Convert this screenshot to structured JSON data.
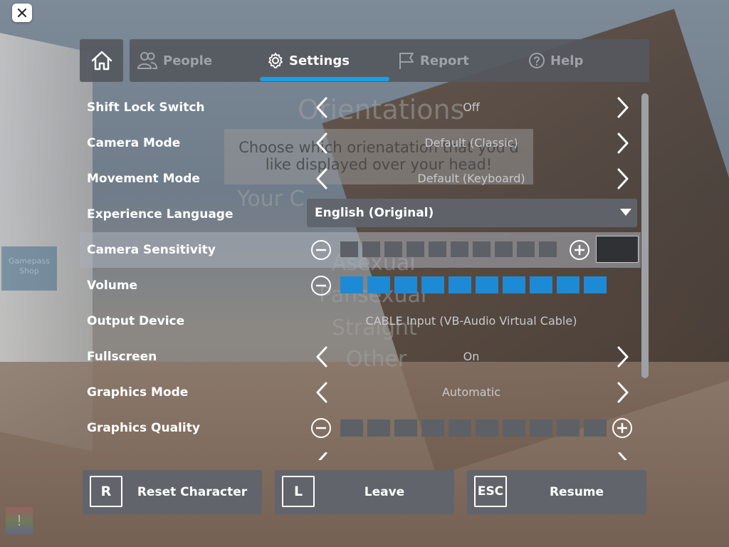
{
  "tabs": [
    {
      "label": "People",
      "icon": "people-icon",
      "active": false
    },
    {
      "label": "Settings",
      "icon": "gear-icon",
      "active": true
    },
    {
      "label": "Report",
      "icon": "flag-icon",
      "active": false
    },
    {
      "label": "Help",
      "icon": "help-icon",
      "active": false
    }
  ],
  "settings": {
    "shift_lock": {
      "label": "Shift Lock Switch",
      "value": "Off"
    },
    "camera_mode": {
      "label": "Camera Mode",
      "value": "Default (Classic)"
    },
    "movement_mode": {
      "label": "Movement Mode",
      "value": "Default (Keyboard)"
    },
    "language": {
      "label": "Experience Language",
      "value": "English (Original)"
    },
    "camera_sensitivity": {
      "label": "Camera Sensitivity",
      "filled_segments": 0,
      "total_segments": 10,
      "text_value": ""
    },
    "volume": {
      "label": "Volume",
      "filled_segments": 10,
      "total_segments": 10
    },
    "output_device": {
      "label": "Output Device",
      "value": "CABLE Input (VB-Audio Virtual Cable)"
    },
    "fullscreen": {
      "label": "Fullscreen",
      "value": "On"
    },
    "graphics_mode": {
      "label": "Graphics Mode",
      "value": "Automatic"
    },
    "graphics_quality": {
      "label": "Graphics Quality",
      "filled_segments": 0,
      "total_segments": 10
    }
  },
  "actions": {
    "reset": {
      "key": "R",
      "label": "Reset Character"
    },
    "leave": {
      "key": "L",
      "label": "Leave"
    },
    "resume": {
      "key": "ESC",
      "label": "Resume"
    }
  },
  "background": {
    "title": "Orientations",
    "prompt": "Choose which orienatation that you'd like displayed over your head!",
    "subtitle": "Your C",
    "options": [
      "Asexual",
      "Pansexual",
      "Straight",
      "Other"
    ],
    "shop_label": "Gamepass Shop",
    "corner_mark": "!"
  },
  "colors": {
    "accent": "#1a9ee8",
    "segment_on": "#1d8ad6",
    "segment_off": "#5d6066",
    "panel": "#55585f"
  }
}
